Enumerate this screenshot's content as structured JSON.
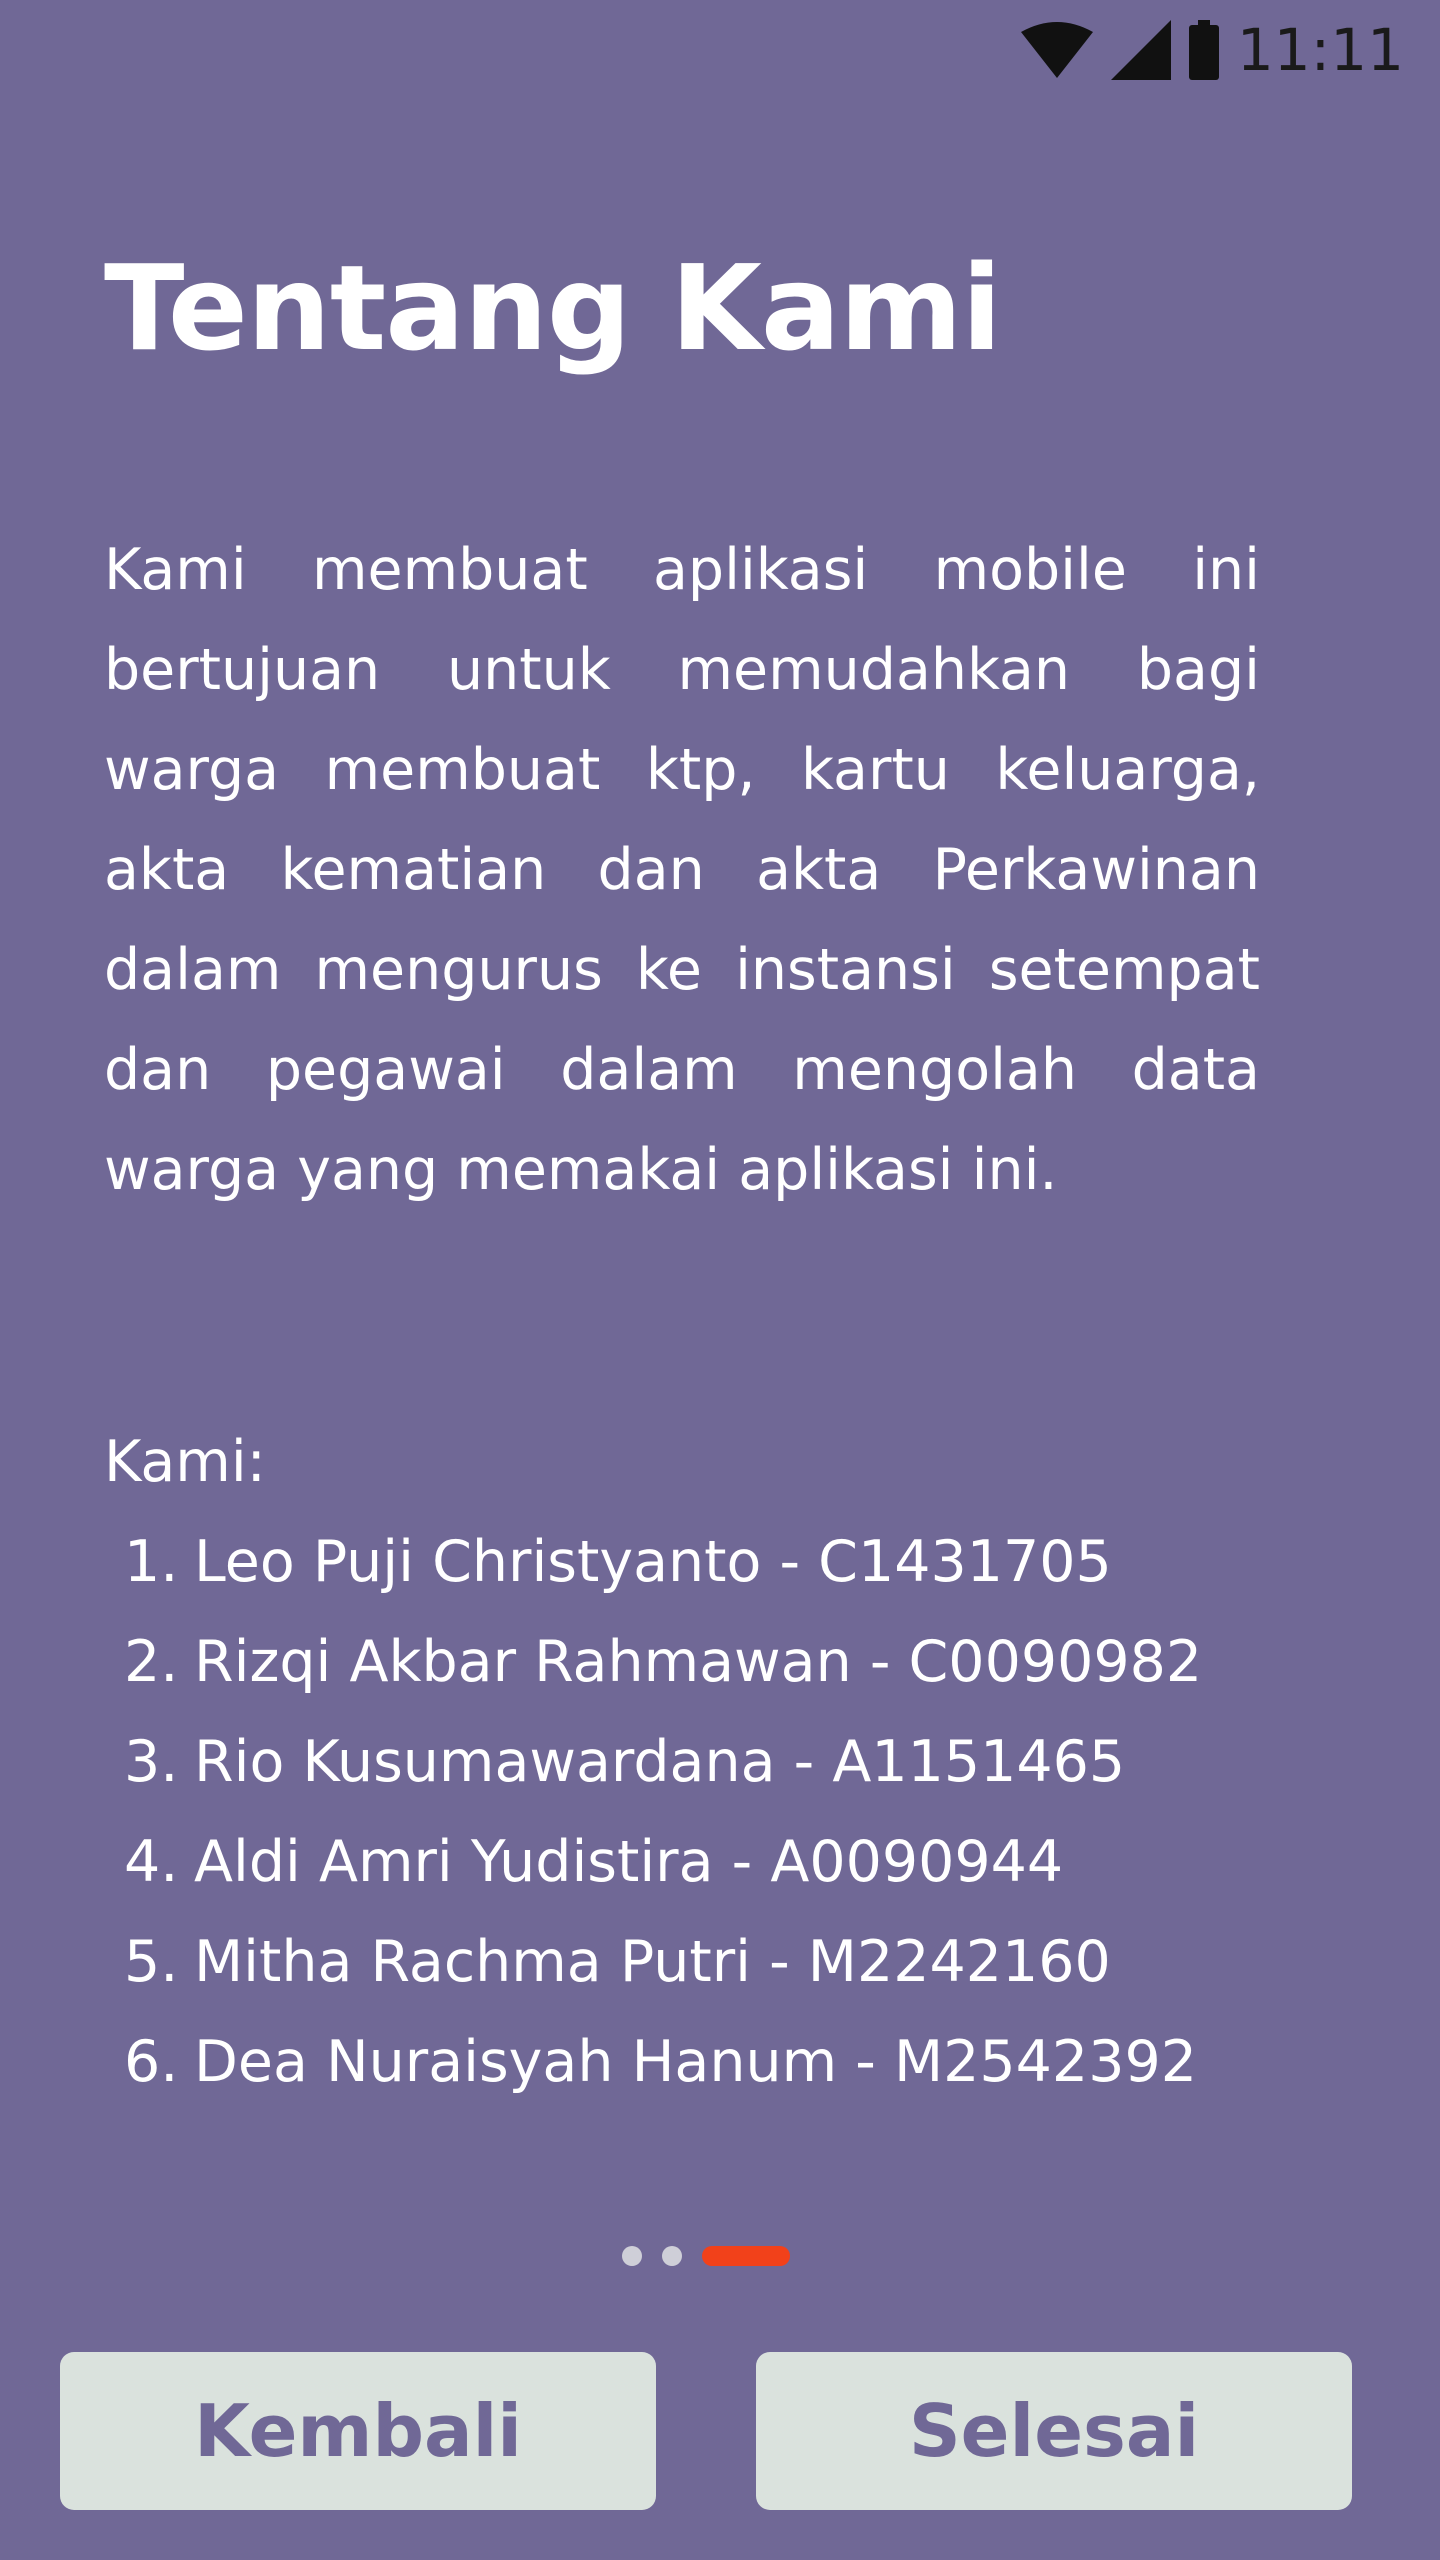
{
  "status_bar": {
    "time": "11:11",
    "icons": [
      "wifi-icon",
      "signal-icon",
      "battery-icon"
    ]
  },
  "page": {
    "title": "Tentang Kami",
    "description": "Kami membuat aplikasi mobile ini bertujuan untuk memudahkan bagi warga membuat ktp, kartu keluarga, akta kematian dan akta Perkawinan dalam mengurus ke instansi setempat dan pegawai dalam mengolah data warga yang memakai aplikasi ini.",
    "members_label": "Kami:",
    "members": [
      {
        "num": "1.",
        "text": "Leo Puji Christyanto - C1431705"
      },
      {
        "num": "2.",
        "text": "Rizqi Akbar Rahmawan - C0090982"
      },
      {
        "num": "3.",
        "text": "Rio Kusumawardana - A1151465"
      },
      {
        "num": "4.",
        "text": "Aldi Amri Yudistira - A0090944"
      },
      {
        "num": "5.",
        "text": "Mitha Rachma Putri - M2242160"
      },
      {
        "num": "6.",
        "text": "Dea Nuraisyah Hanum - M2542392"
      }
    ]
  },
  "pager": {
    "total": 3,
    "active": 3
  },
  "buttons": {
    "back_label": "Kembali",
    "done_label": "Selesai"
  },
  "colors": {
    "background": "#706896",
    "button_bg": "#dae2dd",
    "button_text": "#706896",
    "indicator_active": "#f2411a",
    "indicator_inactive": "#cfcfd8"
  }
}
